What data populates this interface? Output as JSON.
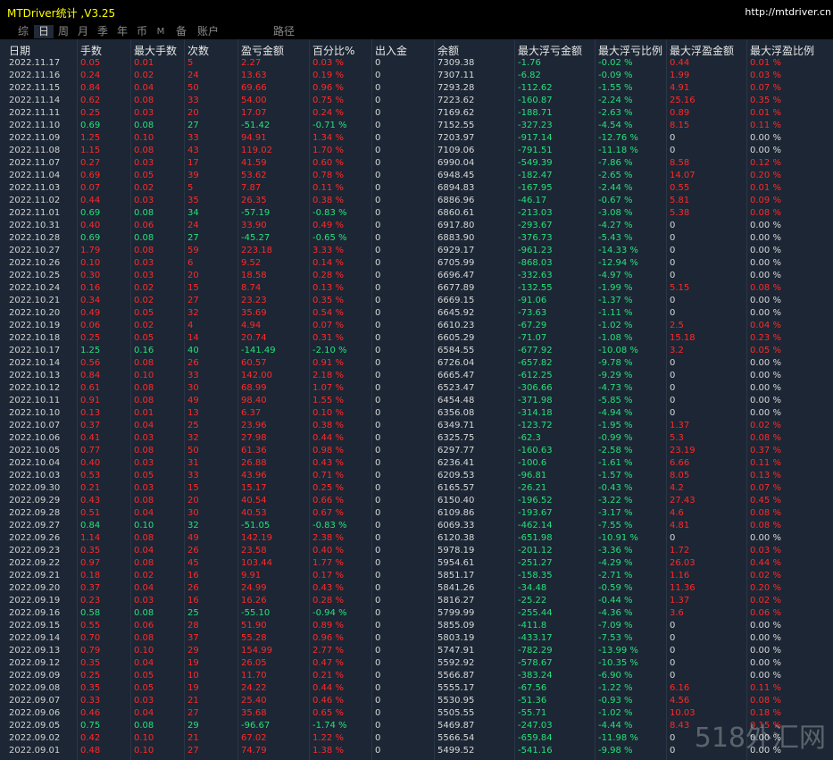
{
  "window": {
    "title": "MTDriver统计 ,V3.25",
    "url": "http://mtdriver.cn"
  },
  "tabs": [
    {
      "label": "综",
      "active": false
    },
    {
      "label": "日",
      "active": true
    },
    {
      "label": "周",
      "active": false
    },
    {
      "label": "月",
      "active": false
    },
    {
      "label": "季",
      "active": false
    },
    {
      "label": "年",
      "active": false
    },
    {
      "label": "币",
      "active": false
    },
    {
      "label": "M",
      "active": false
    },
    {
      "label": "备",
      "active": false
    },
    {
      "label": "账户",
      "active": false
    },
    {
      "label": "路径",
      "active": false
    }
  ],
  "columns": [
    "日期",
    "手数",
    "最大手数",
    "次数",
    "盈亏金额",
    "百分比%",
    "出入金",
    "余额",
    "最大浮亏金额",
    "最大浮亏比例",
    "最大浮盈金额",
    "最大浮盈比例"
  ],
  "colors": {
    "loss": "#ff2a2a",
    "profit": "#26e07a",
    "neutral": "#d8d8d8",
    "background": "#1c2634"
  },
  "rows": [
    [
      "2022.11.17",
      "0.05",
      "0.01",
      "5",
      "2.27",
      "0.03 %",
      "0",
      "7309.38",
      "-1.76",
      "-0.02 %",
      "0.44",
      "0.01 %"
    ],
    [
      "2022.11.16",
      "0.24",
      "0.02",
      "24",
      "13.63",
      "0.19 %",
      "0",
      "7307.11",
      "-6.82",
      "-0.09 %",
      "1.99",
      "0.03 %"
    ],
    [
      "2022.11.15",
      "0.84",
      "0.04",
      "50",
      "69.66",
      "0.96 %",
      "0",
      "7293.28",
      "-112.62",
      "-1.55 %",
      "4.91",
      "0.07 %"
    ],
    [
      "2022.11.14",
      "0.62",
      "0.08",
      "33",
      "54.00",
      "0.75 %",
      "0",
      "7223.62",
      "-160.87",
      "-2.24 %",
      "25.16",
      "0.35 %"
    ],
    [
      "2022.11.11",
      "0.25",
      "0.03",
      "20",
      "17.07",
      "0.24 %",
      "0",
      "7169.62",
      "-188.71",
      "-2.63 %",
      "0.89",
      "0.01 %"
    ],
    [
      "2022.11.10",
      "0.69",
      "0.08",
      "27",
      "-51.42",
      "-0.71 %",
      "0",
      "7152.55",
      "-327.23",
      "-4.54 %",
      "8.15",
      "0.11 %"
    ],
    [
      "2022.11.09",
      "1.25",
      "0.10",
      "33",
      "94.91",
      "1.34 %",
      "0",
      "7203.97",
      "-917.14",
      "-12.76 %",
      "0",
      "0.00 %"
    ],
    [
      "2022.11.08",
      "1.15",
      "0.08",
      "43",
      "119.02",
      "1.70 %",
      "0",
      "7109.06",
      "-791.51",
      "-11.18 %",
      "0",
      "0.00 %"
    ],
    [
      "2022.11.07",
      "0.27",
      "0.03",
      "17",
      "41.59",
      "0.60 %",
      "0",
      "6990.04",
      "-549.39",
      "-7.86 %",
      "8.58",
      "0.12 %"
    ],
    [
      "2022.11.04",
      "0.69",
      "0.05",
      "39",
      "53.62",
      "0.78 %",
      "0",
      "6948.45",
      "-182.47",
      "-2.65 %",
      "14.07",
      "0.20 %"
    ],
    [
      "2022.11.03",
      "0.07",
      "0.02",
      "5",
      "7.87",
      "0.11 %",
      "0",
      "6894.83",
      "-167.95",
      "-2.44 %",
      "0.55",
      "0.01 %"
    ],
    [
      "2022.11.02",
      "0.44",
      "0.03",
      "35",
      "26.35",
      "0.38 %",
      "0",
      "6886.96",
      "-46.17",
      "-0.67 %",
      "5.81",
      "0.09 %"
    ],
    [
      "2022.11.01",
      "0.69",
      "0.08",
      "34",
      "-57.19",
      "-0.83 %",
      "0",
      "6860.61",
      "-213.03",
      "-3.08 %",
      "5.38",
      "0.08 %"
    ],
    [
      "2022.10.31",
      "0.40",
      "0.06",
      "24",
      "33.90",
      "0.49 %",
      "0",
      "6917.80",
      "-293.67",
      "-4.27 %",
      "0",
      "0.00 %"
    ],
    [
      "2022.10.28",
      "0.69",
      "0.08",
      "27",
      "-45.27",
      "-0.65 %",
      "0",
      "6883.90",
      "-376.73",
      "-5.43 %",
      "0",
      "0.00 %"
    ],
    [
      "2022.10.27",
      "1.79",
      "0.08",
      "59",
      "223.18",
      "3.33 %",
      "0",
      "6929.17",
      "-961.23",
      "-14.33 %",
      "0",
      "0.00 %"
    ],
    [
      "2022.10.26",
      "0.10",
      "0.03",
      "6",
      "9.52",
      "0.14 %",
      "0",
      "6705.99",
      "-868.03",
      "-12.94 %",
      "0",
      "0.00 %"
    ],
    [
      "2022.10.25",
      "0.30",
      "0.03",
      "20",
      "18.58",
      "0.28 %",
      "0",
      "6696.47",
      "-332.63",
      "-4.97 %",
      "0",
      "0.00 %"
    ],
    [
      "2022.10.24",
      "0.16",
      "0.02",
      "15",
      "8.74",
      "0.13 %",
      "0",
      "6677.89",
      "-132.55",
      "-1.99 %",
      "5.15",
      "0.08 %"
    ],
    [
      "2022.10.21",
      "0.34",
      "0.02",
      "27",
      "23.23",
      "0.35 %",
      "0",
      "6669.15",
      "-91.06",
      "-1.37 %",
      "0",
      "0.00 %"
    ],
    [
      "2022.10.20",
      "0.49",
      "0.05",
      "32",
      "35.69",
      "0.54 %",
      "0",
      "6645.92",
      "-73.63",
      "-1.11 %",
      "0",
      "0.00 %"
    ],
    [
      "2022.10.19",
      "0.06",
      "0.02",
      "4",
      "4.94",
      "0.07 %",
      "0",
      "6610.23",
      "-67.29",
      "-1.02 %",
      "2.5",
      "0.04 %"
    ],
    [
      "2022.10.18",
      "0.25",
      "0.05",
      "14",
      "20.74",
      "0.31 %",
      "0",
      "6605.29",
      "-71.07",
      "-1.08 %",
      "15.18",
      "0.23 %"
    ],
    [
      "2022.10.17",
      "1.25",
      "0.16",
      "40",
      "-141.49",
      "-2.10 %",
      "0",
      "6584.55",
      "-677.92",
      "-10.08 %",
      "3.2",
      "0.05 %"
    ],
    [
      "2022.10.14",
      "0.56",
      "0.08",
      "26",
      "60.57",
      "0.91 %",
      "0",
      "6726.04",
      "-657.82",
      "-9.78 %",
      "0",
      "0.00 %"
    ],
    [
      "2022.10.13",
      "0.84",
      "0.10",
      "33",
      "142.00",
      "2.18 %",
      "0",
      "6665.47",
      "-612.25",
      "-9.29 %",
      "0",
      "0.00 %"
    ],
    [
      "2022.10.12",
      "0.61",
      "0.08",
      "30",
      "68.99",
      "1.07 %",
      "0",
      "6523.47",
      "-306.66",
      "-4.73 %",
      "0",
      "0.00 %"
    ],
    [
      "2022.10.11",
      "0.91",
      "0.08",
      "49",
      "98.40",
      "1.55 %",
      "0",
      "6454.48",
      "-371.98",
      "-5.85 %",
      "0",
      "0.00 %"
    ],
    [
      "2022.10.10",
      "0.13",
      "0.01",
      "13",
      "6.37",
      "0.10 %",
      "0",
      "6356.08",
      "-314.18",
      "-4.94 %",
      "0",
      "0.00 %"
    ],
    [
      "2022.10.07",
      "0.37",
      "0.04",
      "25",
      "23.96",
      "0.38 %",
      "0",
      "6349.71",
      "-123.72",
      "-1.95 %",
      "1.37",
      "0.02 %"
    ],
    [
      "2022.10.06",
      "0.41",
      "0.03",
      "32",
      "27.98",
      "0.44 %",
      "0",
      "6325.75",
      "-62.3",
      "-0.99 %",
      "5.3",
      "0.08 %"
    ],
    [
      "2022.10.05",
      "0.77",
      "0.08",
      "50",
      "61.36",
      "0.98 %",
      "0",
      "6297.77",
      "-160.63",
      "-2.58 %",
      "23.19",
      "0.37 %"
    ],
    [
      "2022.10.04",
      "0.40",
      "0.03",
      "31",
      "26.88",
      "0.43 %",
      "0",
      "6236.41",
      "-100.6",
      "-1.61 %",
      "6.66",
      "0.11 %"
    ],
    [
      "2022.10.03",
      "0.53",
      "0.05",
      "33",
      "43.96",
      "0.71 %",
      "0",
      "6209.53",
      "-96.81",
      "-1.57 %",
      "8.05",
      "0.13 %"
    ],
    [
      "2022.09.30",
      "0.21",
      "0.03",
      "15",
      "15.17",
      "0.25 %",
      "0",
      "6165.57",
      "-26.21",
      "-0.43 %",
      "4.2",
      "0.07 %"
    ],
    [
      "2022.09.29",
      "0.43",
      "0.08",
      "20",
      "40.54",
      "0.66 %",
      "0",
      "6150.40",
      "-196.52",
      "-3.22 %",
      "27.43",
      "0.45 %"
    ],
    [
      "2022.09.28",
      "0.51",
      "0.04",
      "30",
      "40.53",
      "0.67 %",
      "0",
      "6109.86",
      "-193.67",
      "-3.17 %",
      "4.6",
      "0.08 %"
    ],
    [
      "2022.09.27",
      "0.84",
      "0.10",
      "32",
      "-51.05",
      "-0.83 %",
      "0",
      "6069.33",
      "-462.14",
      "-7.55 %",
      "4.81",
      "0.08 %"
    ],
    [
      "2022.09.26",
      "1.14",
      "0.08",
      "49",
      "142.19",
      "2.38 %",
      "0",
      "6120.38",
      "-651.98",
      "-10.91 %",
      "0",
      "0.00 %"
    ],
    [
      "2022.09.23",
      "0.35",
      "0.04",
      "26",
      "23.58",
      "0.40 %",
      "0",
      "5978.19",
      "-201.12",
      "-3.36 %",
      "1.72",
      "0.03 %"
    ],
    [
      "2022.09.22",
      "0.97",
      "0.08",
      "45",
      "103.44",
      "1.77 %",
      "0",
      "5954.61",
      "-251.27",
      "-4.29 %",
      "26.03",
      "0.44 %"
    ],
    [
      "2022.09.21",
      "0.18",
      "0.02",
      "16",
      "9.91",
      "0.17 %",
      "0",
      "5851.17",
      "-158.35",
      "-2.71 %",
      "1.16",
      "0.02 %"
    ],
    [
      "2022.09.20",
      "0.37",
      "0.04",
      "26",
      "24.99",
      "0.43 %",
      "0",
      "5841.26",
      "-34.48",
      "-0.59 %",
      "11.36",
      "0.20 %"
    ],
    [
      "2022.09.19",
      "0.23",
      "0.03",
      "16",
      "16.26",
      "0.28 %",
      "0",
      "5816.27",
      "-25.22",
      "-0.44 %",
      "1.37",
      "0.02 %"
    ],
    [
      "2022.09.16",
      "0.58",
      "0.08",
      "25",
      "-55.10",
      "-0.94 %",
      "0",
      "5799.99",
      "-255.44",
      "-4.36 %",
      "3.6",
      "0.06 %"
    ],
    [
      "2022.09.15",
      "0.55",
      "0.06",
      "28",
      "51.90",
      "0.89 %",
      "0",
      "5855.09",
      "-411.8",
      "-7.09 %",
      "0",
      "0.00 %"
    ],
    [
      "2022.09.14",
      "0.70",
      "0.08",
      "37",
      "55.28",
      "0.96 %",
      "0",
      "5803.19",
      "-433.17",
      "-7.53 %",
      "0",
      "0.00 %"
    ],
    [
      "2022.09.13",
      "0.79",
      "0.10",
      "29",
      "154.99",
      "2.77 %",
      "0",
      "5747.91",
      "-782.29",
      "-13.99 %",
      "0",
      "0.00 %"
    ],
    [
      "2022.09.12",
      "0.35",
      "0.04",
      "19",
      "26.05",
      "0.47 %",
      "0",
      "5592.92",
      "-578.67",
      "-10.35 %",
      "0",
      "0.00 %"
    ],
    [
      "2022.09.09",
      "0.25",
      "0.05",
      "10",
      "11.70",
      "0.21 %",
      "0",
      "5566.87",
      "-383.24",
      "-6.90 %",
      "0",
      "0.00 %"
    ],
    [
      "2022.09.08",
      "0.35",
      "0.05",
      "19",
      "24.22",
      "0.44 %",
      "0",
      "5555.17",
      "-67.56",
      "-1.22 %",
      "6.16",
      "0.11 %"
    ],
    [
      "2022.09.07",
      "0.33",
      "0.03",
      "21",
      "25.40",
      "0.46 %",
      "0",
      "5530.95",
      "-51.36",
      "-0.93 %",
      "4.56",
      "0.08 %"
    ],
    [
      "2022.09.06",
      "0.46",
      "0.04",
      "27",
      "35.68",
      "0.65 %",
      "0",
      "5505.55",
      "-55.71",
      "-1.02 %",
      "10.03",
      "0.18 %"
    ],
    [
      "2022.09.05",
      "0.75",
      "0.08",
      "29",
      "-96.67",
      "-1.74 %",
      "0",
      "5469.87",
      "-247.03",
      "-4.44 %",
      "8.43",
      "0.15 %"
    ],
    [
      "2022.09.02",
      "0.42",
      "0.10",
      "21",
      "67.02",
      "1.22 %",
      "0",
      "5566.54",
      "-659.84",
      "-11.98 %",
      "0",
      "0.00 %"
    ],
    [
      "2022.09.01",
      "0.48",
      "0.10",
      "27",
      "74.79",
      "1.38 %",
      "0",
      "5499.52",
      "-541.16",
      "-9.98 %",
      "0",
      "0.00 %"
    ]
  ],
  "watermark": "518外汇网"
}
